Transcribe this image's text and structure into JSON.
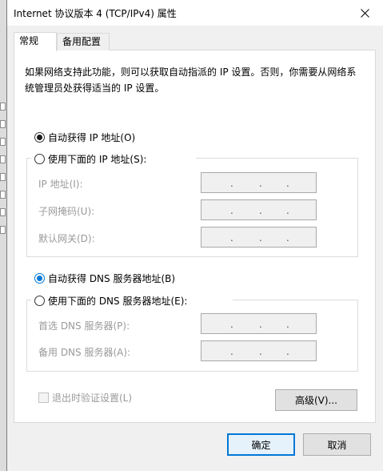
{
  "window": {
    "title": "Internet 协议版本 4 (TCP/IPv4) 属性"
  },
  "tabs": [
    {
      "label": "常规",
      "active": true
    },
    {
      "label": "备用配置",
      "active": false
    }
  ],
  "description": "如果网络支持此功能，则可以获取自动指派的 IP 设置。否则，你需要从网络系统管理员处获得适当的 IP 设置。",
  "ip_section": {
    "auto_label": "自动获得 IP 地址(O)",
    "manual_label": "使用下面的 IP 地址(S):",
    "selected": "auto",
    "fields": [
      {
        "label": "IP 地址(I):",
        "value": ". . ."
      },
      {
        "label": "子网掩码(U):",
        "value": ". . ."
      },
      {
        "label": "默认网关(D):",
        "value": ". . ."
      }
    ]
  },
  "dns_section": {
    "auto_label": "自动获得 DNS 服务器地址(B)",
    "manual_label": "使用下面的 DNS 服务器地址(E):",
    "selected": "auto",
    "fields": [
      {
        "label": "首选 DNS 服务器(P):",
        "value": ". . ."
      },
      {
        "label": "备用 DNS 服务器(A):",
        "value": ". . ."
      }
    ]
  },
  "validate_checkbox": {
    "label": "退出时验证设置(L)",
    "checked": false,
    "disabled": true
  },
  "buttons": {
    "advanced": "高级(V)...",
    "ok": "确定",
    "cancel": "取消"
  },
  "colors": {
    "accent": "#0078d7",
    "disabled_text": "#9a9a9a"
  }
}
